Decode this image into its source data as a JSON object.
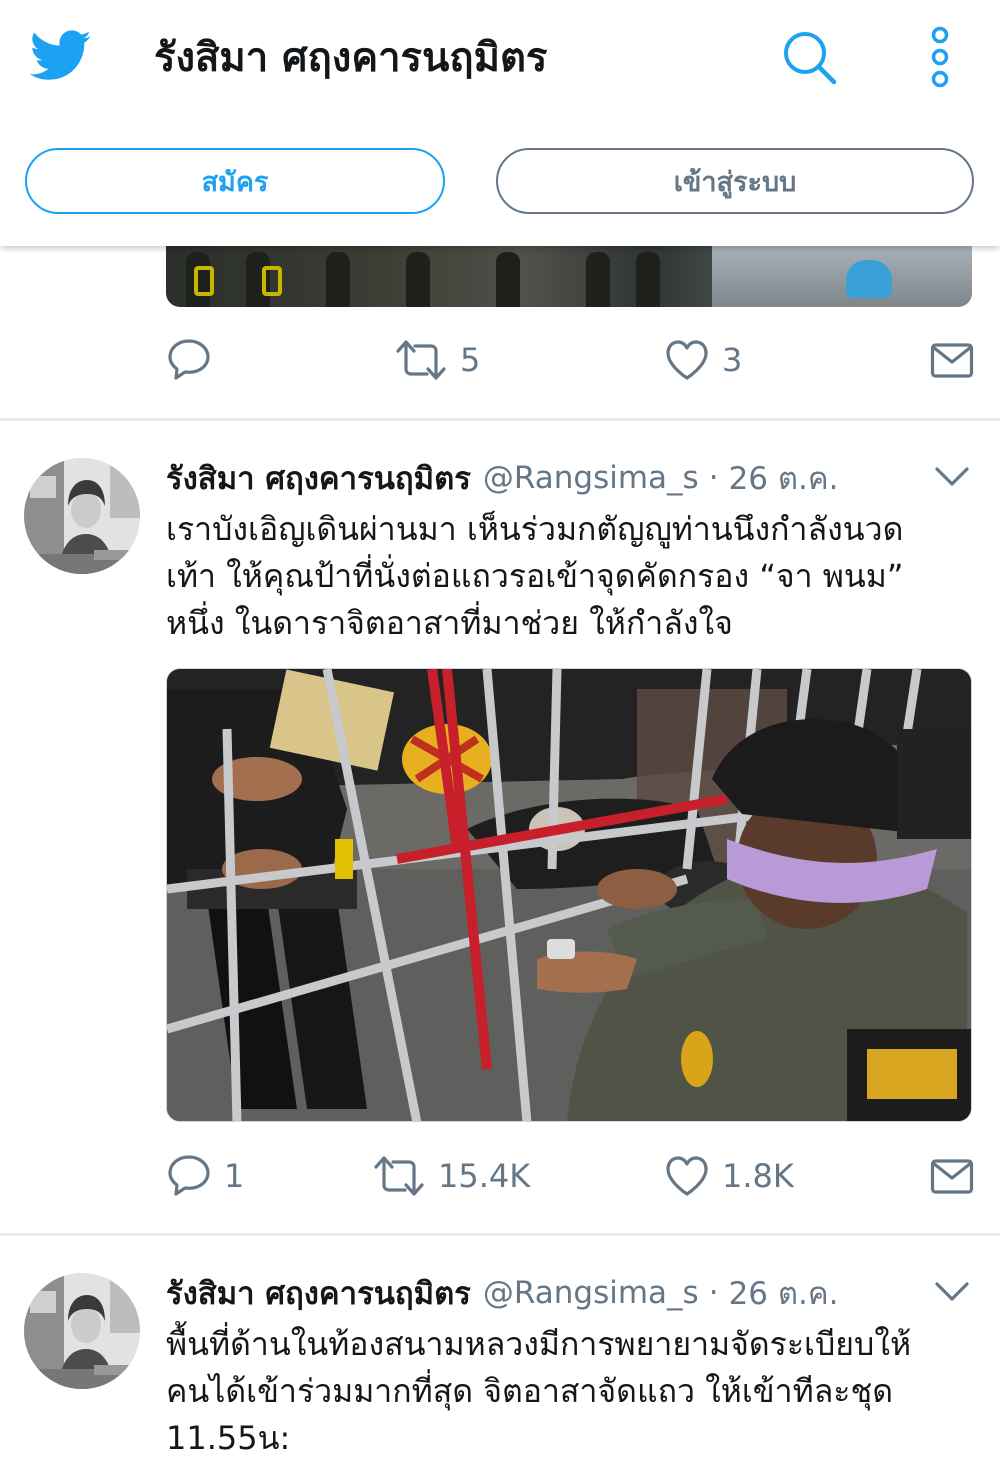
{
  "header": {
    "title": "รังสิมา ศฤงคารนฤมิตร",
    "signup_label": "สมัคร",
    "login_label": "เข้าสู่ระบบ",
    "icons": [
      "twitter-bird-icon",
      "search-icon",
      "more-options-icon"
    ],
    "accent_color": "#1da1f2"
  },
  "tweets": [
    {
      "partial": true,
      "actions": {
        "reply_count": "",
        "retweet_count": "5",
        "like_count": "3"
      }
    },
    {
      "name": "รังสิมา ศฤงคารนฤมิตร",
      "handle": "@Rangsima_s",
      "separator": "·",
      "date": "26 ต.ค.",
      "text": "เราบังเอิญเดินผ่านมา เห็นร่วมกตัญญูท่านนึงกำลังนวด\nเท้า ให้คุณป้าที่นั่งต่อแถวรอเข้าจุดคัดกรอง “จา พนม”\nหนึ่ง ในดาราจิตอาสาที่มาช่วย ให้กำลังใจ",
      "actions": {
        "reply_count": "1",
        "retweet_count": "15.4K",
        "like_count": "1.8K"
      }
    },
    {
      "name": "รังสิมา ศฤงคารนฤมิตร",
      "handle": "@Rangsima_s",
      "separator": "·",
      "date": "26 ต.ค.",
      "text": "พื้นที่ด้านในท้องสนามหลวงมีการพยายามจัดระเบียบให้\nคนได้เข้าร่วมมากที่สุด จิตอาสาจัดแถว ให้เข้าทีละชุด\n11.55น:"
    }
  ]
}
